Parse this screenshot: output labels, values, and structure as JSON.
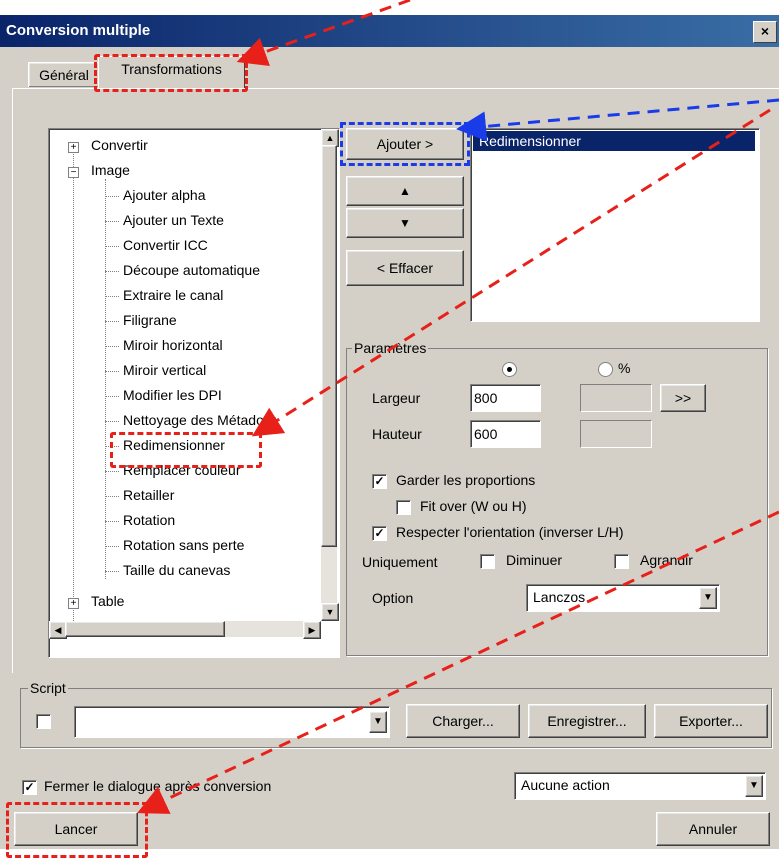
{
  "window": {
    "title": "Conversion multiple",
    "close_label": "×"
  },
  "tabs": [
    {
      "label": "Général"
    },
    {
      "label": "Transformations"
    }
  ],
  "tree": {
    "items": [
      {
        "label": "Convertir",
        "level": 0,
        "expander": "+"
      },
      {
        "label": "Image",
        "level": 0,
        "expander": "−"
      },
      {
        "label": "Ajouter alpha",
        "level": 1
      },
      {
        "label": "Ajouter un Texte",
        "level": 1
      },
      {
        "label": "Convertir ICC",
        "level": 1
      },
      {
        "label": "Découpe automatique",
        "level": 1
      },
      {
        "label": "Extraire le canal",
        "level": 1
      },
      {
        "label": "Filigrane",
        "level": 1
      },
      {
        "label": "Miroir horizontal",
        "level": 1
      },
      {
        "label": "Miroir vertical",
        "level": 1
      },
      {
        "label": "Modifier les DPI",
        "level": 1
      },
      {
        "label": "Nettoyage des Métadonr",
        "level": 1
      },
      {
        "label": "Redimensionner",
        "level": 1
      },
      {
        "label": "Remplacer couleur",
        "level": 1
      },
      {
        "label": "Retailler",
        "level": 1
      },
      {
        "label": "Rotation",
        "level": 1
      },
      {
        "label": "Rotation sans perte",
        "level": 1
      },
      {
        "label": "Taille du canevas",
        "level": 1
      },
      {
        "label": "Table",
        "level": 0,
        "expander": "+"
      }
    ]
  },
  "buttons": {
    "add": "Ajouter >",
    "up": "▲",
    "down": "▼",
    "clear": "< Effacer",
    "more": ">>"
  },
  "selected_list": {
    "items": [
      "Redimensionner"
    ]
  },
  "params": {
    "title": "Paramètres",
    "pixel_radio": "",
    "percent_radio": "%",
    "width_label": "Largeur",
    "width_value": "800",
    "height_label": "Hauteur",
    "height_value": "600",
    "keep_ratio": "Garder les proportions",
    "fit_over": "Fit over (W ou H)",
    "respect_orientation": "Respecter l'orientation (inverser L/H)",
    "only_label": "Uniquement",
    "decrease": "Diminuer",
    "increase": "Agrandir",
    "option_label": "Option",
    "option_value": "Lanczos"
  },
  "script": {
    "title": "Script",
    "load": "Charger...",
    "save": "Enregistrer...",
    "export": "Exporter..."
  },
  "footer": {
    "close_after": "Fermer le dialogue après conversion",
    "action_value": "Aucune action",
    "run": "Lancer",
    "cancel": "Annuler"
  },
  "colors": {
    "accent_red": "#e8201a",
    "accent_blue": "#1a3ce8",
    "selection": "#0a246a"
  }
}
